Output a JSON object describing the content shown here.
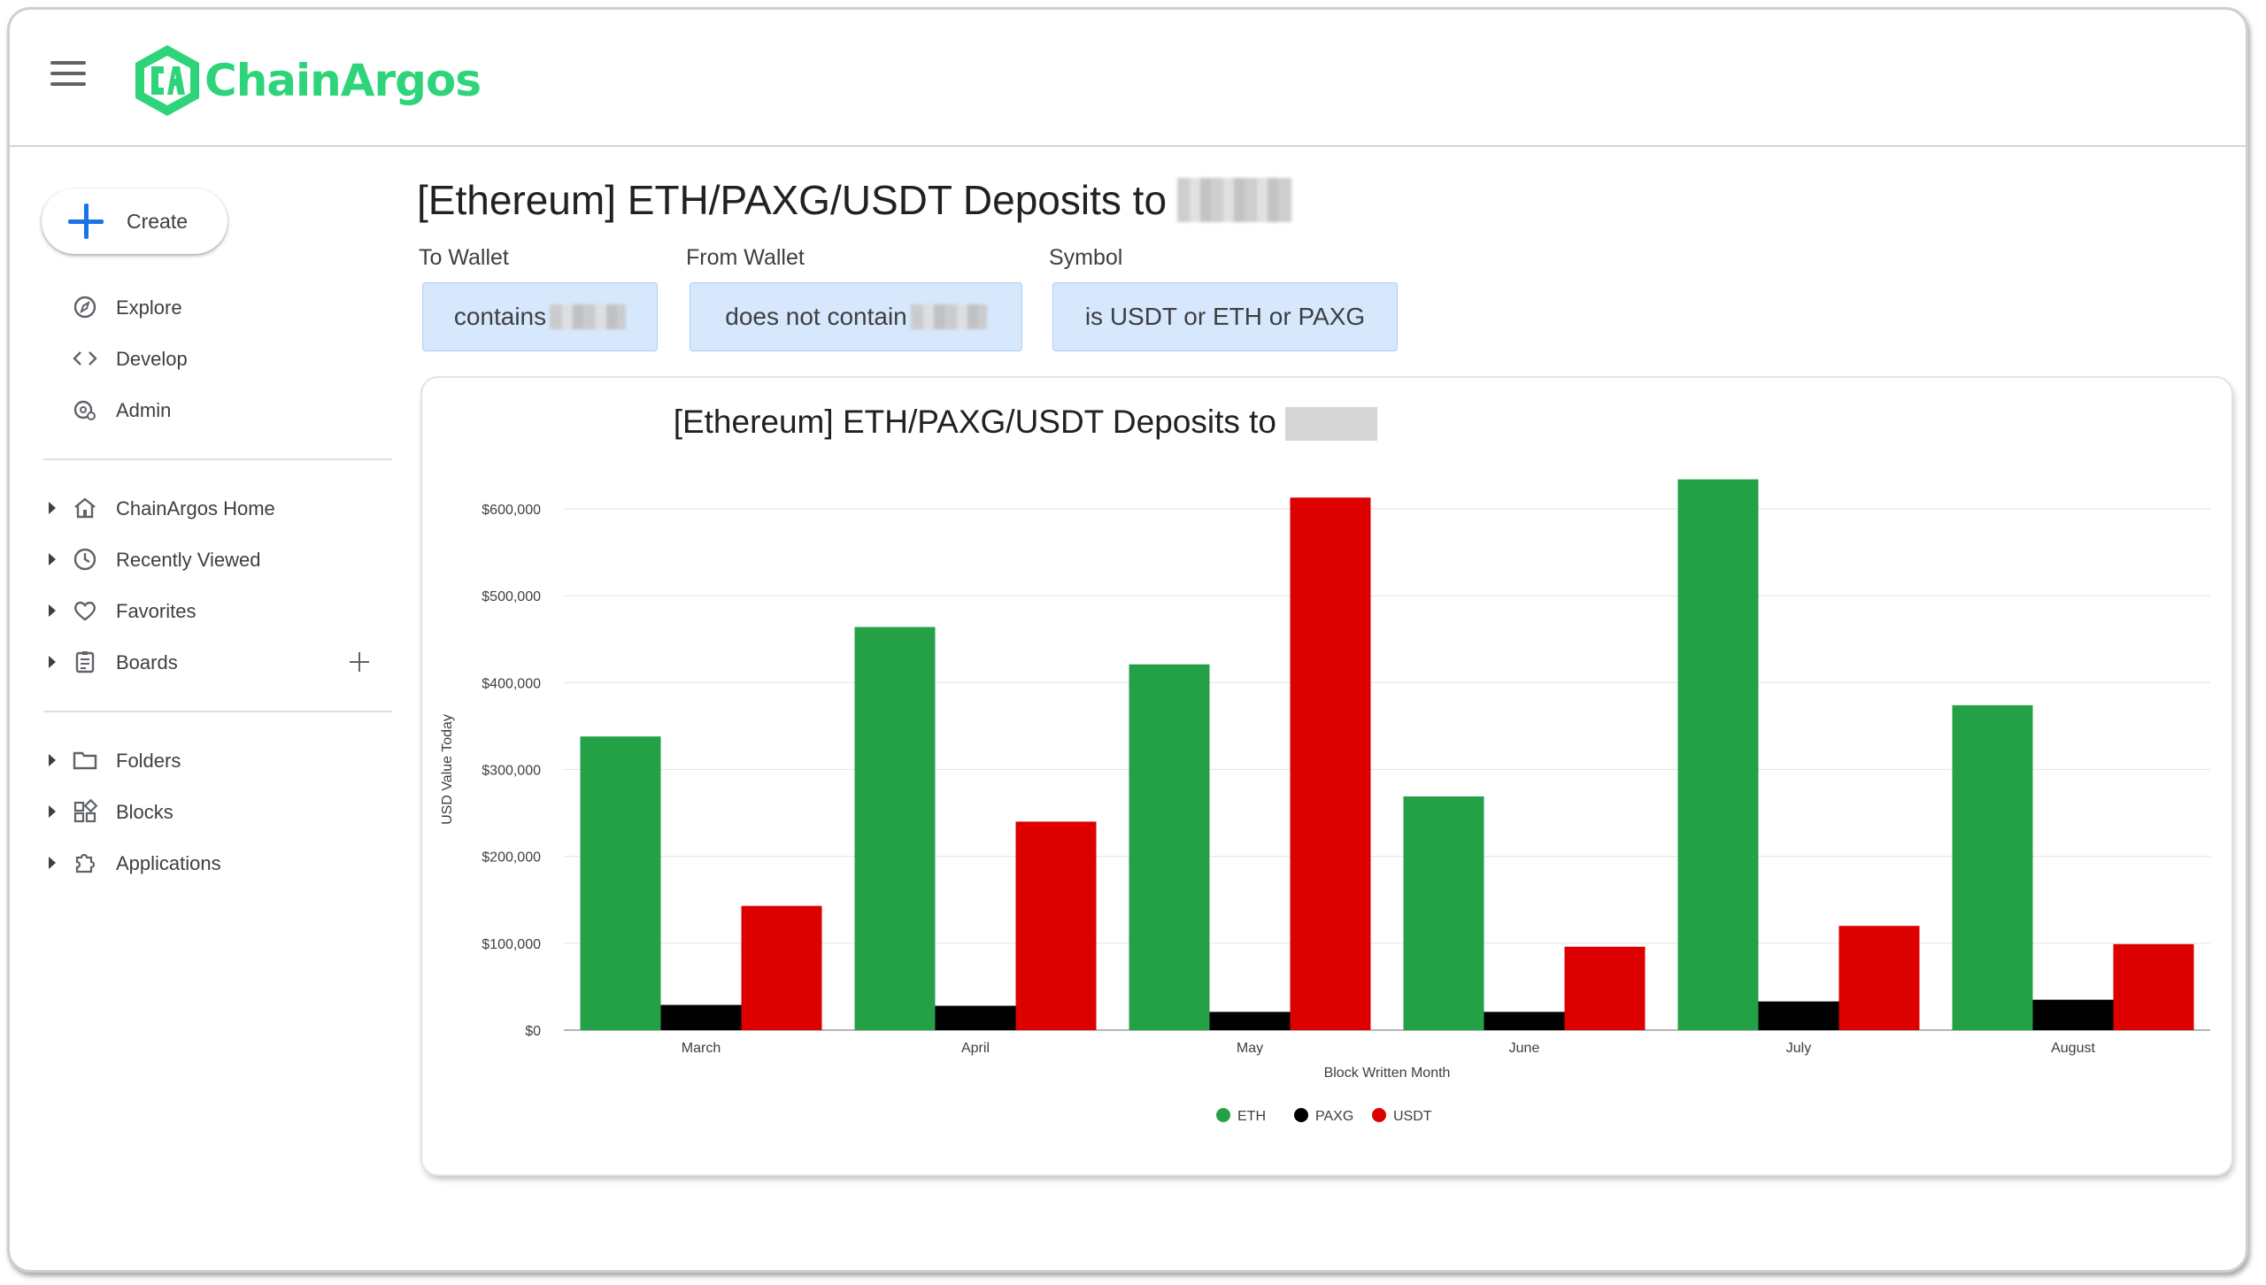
{
  "app": {
    "brand": "ChainArgos",
    "brand_color": "#2ed47a"
  },
  "sidebar": {
    "create_label": "Create",
    "primary": [
      {
        "label": "Explore",
        "icon": "compass-icon"
      },
      {
        "label": "Develop",
        "icon": "code-icon"
      },
      {
        "label": "Admin",
        "icon": "admin-gear-icon"
      }
    ],
    "sections": [
      {
        "label": "ChainArgos Home",
        "icon": "home-icon"
      },
      {
        "label": "Recently Viewed",
        "icon": "clock-icon"
      },
      {
        "label": "Favorites",
        "icon": "heart-icon"
      },
      {
        "label": "Boards",
        "icon": "board-icon"
      }
    ],
    "library": [
      {
        "label": "Folders",
        "icon": "folder-icon"
      },
      {
        "label": "Blocks",
        "icon": "blocks-icon"
      },
      {
        "label": "Applications",
        "icon": "puzzle-icon"
      }
    ]
  },
  "page": {
    "title": "[Ethereum] ETH/PAXG/USDT Deposits to",
    "filters": [
      {
        "label": "To Wallet",
        "value": "contains"
      },
      {
        "label": "From Wallet",
        "value": "does not contain"
      },
      {
        "label": "Symbol",
        "value": "is USDT or ETH or PAXG"
      }
    ]
  },
  "chart_data": {
    "type": "bar",
    "title": "[Ethereum] ETH/PAXG/USDT Deposits to",
    "xlabel": "Block Written Month",
    "ylabel": "USD Value Today",
    "categories": [
      "March",
      "April",
      "May",
      "June",
      "July",
      "August"
    ],
    "ylim": [
      0,
      600000
    ],
    "yticks": [
      "$0",
      "$100,000",
      "$200,000",
      "$300,000",
      "$400,000",
      "$500,000",
      "$600,000"
    ],
    "grid": true,
    "legend_position": "bottom",
    "series": [
      {
        "name": "ETH",
        "color": "#24a047",
        "values": [
          338000,
          464000,
          421000,
          269000,
          634000,
          374000
        ]
      },
      {
        "name": "PAXG",
        "color": "#000000",
        "values": [
          29000,
          28000,
          21000,
          21000,
          33000,
          35000
        ]
      },
      {
        "name": "USDT",
        "color": "#dd0000",
        "values": [
          143000,
          240000,
          613000,
          96000,
          120000,
          99000
        ]
      }
    ]
  }
}
